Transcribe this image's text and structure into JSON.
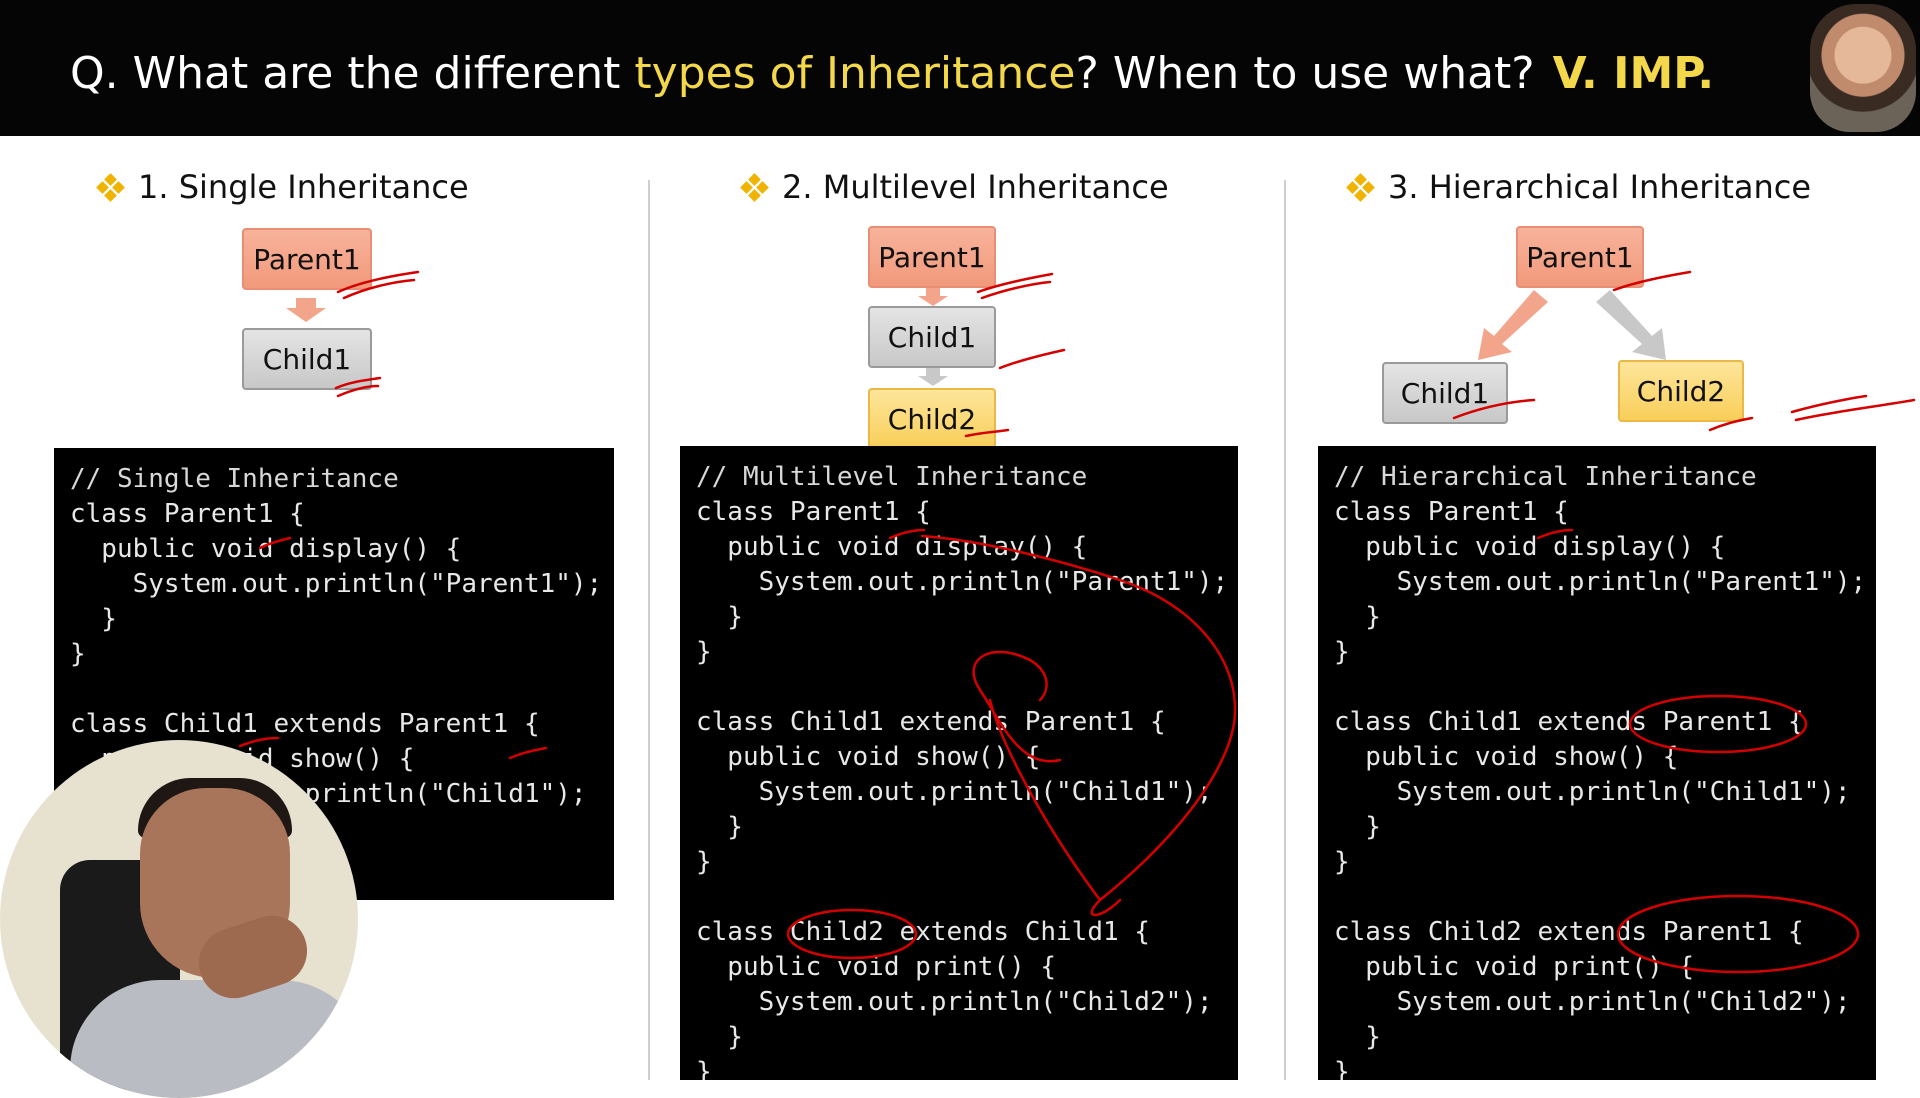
{
  "header": {
    "title_prefix": "Q. What are the different ",
    "title_highlight": "types of Inheritance",
    "title_suffix": "? When to use what?",
    "badge": "V. IMP."
  },
  "colors": {
    "accent_yellow": "#f2d84a",
    "parent_fill": "#f2997b",
    "child_fill": "#c8c8c8",
    "child2_fill": "#f9cf5a",
    "ink_red": "#d40000"
  },
  "sections": [
    {
      "heading": "1. Single Inheritance",
      "nodes": [
        "Parent1",
        "Child1"
      ],
      "code": [
        "// Single Inheritance",
        "class Parent1 {",
        "  public void display() {",
        "    System.out.println(\"Parent1\");",
        "  }",
        "}",
        "",
        "class Child1 extends Parent1 {",
        "  public void show() {",
        "    System.out.println(\"Child1\");",
        "  }",
        "}"
      ]
    },
    {
      "heading": "2. Multilevel Inheritance",
      "nodes": [
        "Parent1",
        "Child1",
        "Child2"
      ],
      "code": [
        "// Multilevel Inheritance",
        "class Parent1 {",
        "  public void display() {",
        "    System.out.println(\"Parent1\");",
        "  }",
        "}",
        "",
        "class Child1 extends Parent1 {",
        "  public void show() {",
        "    System.out.println(\"Child1\");",
        "  }",
        "}",
        "",
        "class Child2 extends Child1 {",
        "  public void print() {",
        "    System.out.println(\"Child2\");",
        "  }",
        "}"
      ]
    },
    {
      "heading": "3. Hierarchical Inheritance",
      "nodes": [
        "Parent1",
        "Child1",
        "Child2"
      ],
      "code": [
        "// Hierarchical Inheritance",
        "class Parent1 {",
        "  public void display() {",
        "    System.out.println(\"Parent1\");",
        "  }",
        "}",
        "",
        "class Child1 extends Parent1 {",
        "  public void show() {",
        "    System.out.println(\"Child1\");",
        "  }",
        "}",
        "",
        "class Child2 extends Parent1 {",
        "  public void print() {",
        "    System.out.println(\"Child2\");",
        "  }",
        "}"
      ]
    }
  ]
}
